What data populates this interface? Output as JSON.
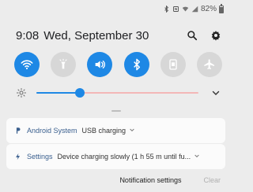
{
  "status_bar": {
    "battery_text": "82%",
    "battery_level": 0.82,
    "icons": [
      "bluetooth-icon",
      "nfc-icon",
      "wifi-icon",
      "signal-icon",
      "battery-icon"
    ]
  },
  "header": {
    "time": "9:08",
    "date": "Wed, September 30",
    "actions": [
      "search-icon",
      "settings-gear-icon"
    ]
  },
  "quick_toggles": [
    {
      "name": "wifi-toggle",
      "icon": "wifi-icon",
      "state": "on"
    },
    {
      "name": "flashlight-toggle",
      "icon": "flashlight-icon",
      "state": "off"
    },
    {
      "name": "sound-toggle",
      "icon": "volume-icon",
      "state": "on"
    },
    {
      "name": "bluetooth-toggle",
      "icon": "bluetooth-icon",
      "state": "on"
    },
    {
      "name": "portrait-toggle",
      "icon": "portrait-lock-icon",
      "state": "off"
    },
    {
      "name": "airplane-toggle",
      "icon": "airplane-icon",
      "state": "off"
    }
  ],
  "brightness": {
    "level": 0.27,
    "icons": [
      "sun-icon",
      "chevron-down-icon"
    ]
  },
  "notifications": [
    {
      "app": "Android System",
      "text": "USB charging",
      "icon": "android-system-icon"
    },
    {
      "app": "Settings",
      "text": "Device charging slowly (1 h 55 m until fu...",
      "icon": "charging-bolt-icon"
    }
  ],
  "footer": {
    "settings_label": "Notification settings",
    "clear_label": "Clear"
  },
  "colors": {
    "accent": "#1e88e5",
    "toggle_off": "#d7d7d7",
    "background": "#ececec",
    "card": "#fbfbfb",
    "clear_disabled": "#b0b0b0",
    "app_name": "#3a5f8e",
    "track": "#f3b7b7"
  }
}
